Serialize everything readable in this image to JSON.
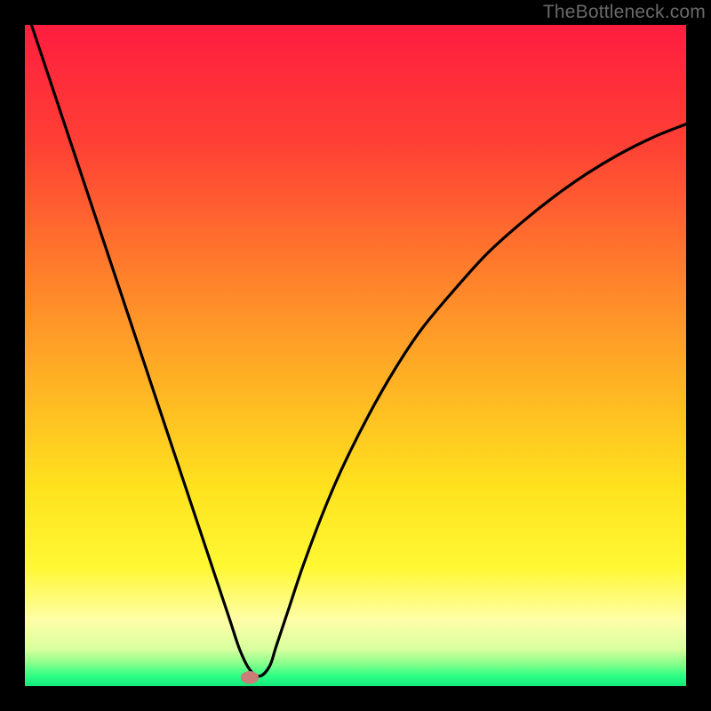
{
  "attribution": "TheBottleneck.com",
  "colors": {
    "frame": "#000000",
    "curve": "#000000",
    "marker_fill": "#c97e78",
    "marker_stroke": "#c97e78",
    "gradient_stops": [
      {
        "offset": 0.0,
        "color": "#ff1d3f"
      },
      {
        "offset": 0.18,
        "color": "#ff4035"
      },
      {
        "offset": 0.36,
        "color": "#ff7a2c"
      },
      {
        "offset": 0.54,
        "color": "#ffb224"
      },
      {
        "offset": 0.7,
        "color": "#ffe21e"
      },
      {
        "offset": 0.82,
        "color": "#fff833"
      },
      {
        "offset": 0.9,
        "color": "#fffea8"
      },
      {
        "offset": 0.945,
        "color": "#d7ff9e"
      },
      {
        "offset": 0.965,
        "color": "#8bff8b"
      },
      {
        "offset": 0.985,
        "color": "#2cff84"
      },
      {
        "offset": 1.0,
        "color": "#12e97b"
      }
    ]
  },
  "chart_data": {
    "type": "line",
    "title": "",
    "xlabel": "",
    "ylabel": "",
    "xlim": [
      0,
      100
    ],
    "ylim": [
      0,
      100
    ],
    "grid": false,
    "legend": false,
    "series": [
      {
        "name": "bottleneck-curve",
        "x": [
          1,
          3,
          5,
          8,
          11,
          14,
          17,
          20,
          23,
          26,
          29,
          31,
          32.5,
          34,
          35.5,
          37,
          38,
          40,
          42,
          45,
          48,
          52,
          56,
          60,
          65,
          70,
          75,
          80,
          85,
          90,
          95,
          100
        ],
        "y": [
          100,
          94,
          88,
          79,
          70,
          61,
          52,
          43,
          34,
          25,
          16,
          10,
          5.5,
          2.5,
          1.5,
          3,
          6,
          12,
          18,
          26,
          33,
          41,
          48,
          54,
          60,
          65.5,
          70,
          74,
          77.5,
          80.5,
          83,
          85
        ]
      }
    ],
    "marker": {
      "x": 34,
      "y": 1.3,
      "rx": 1.3,
      "ry": 0.9
    }
  }
}
